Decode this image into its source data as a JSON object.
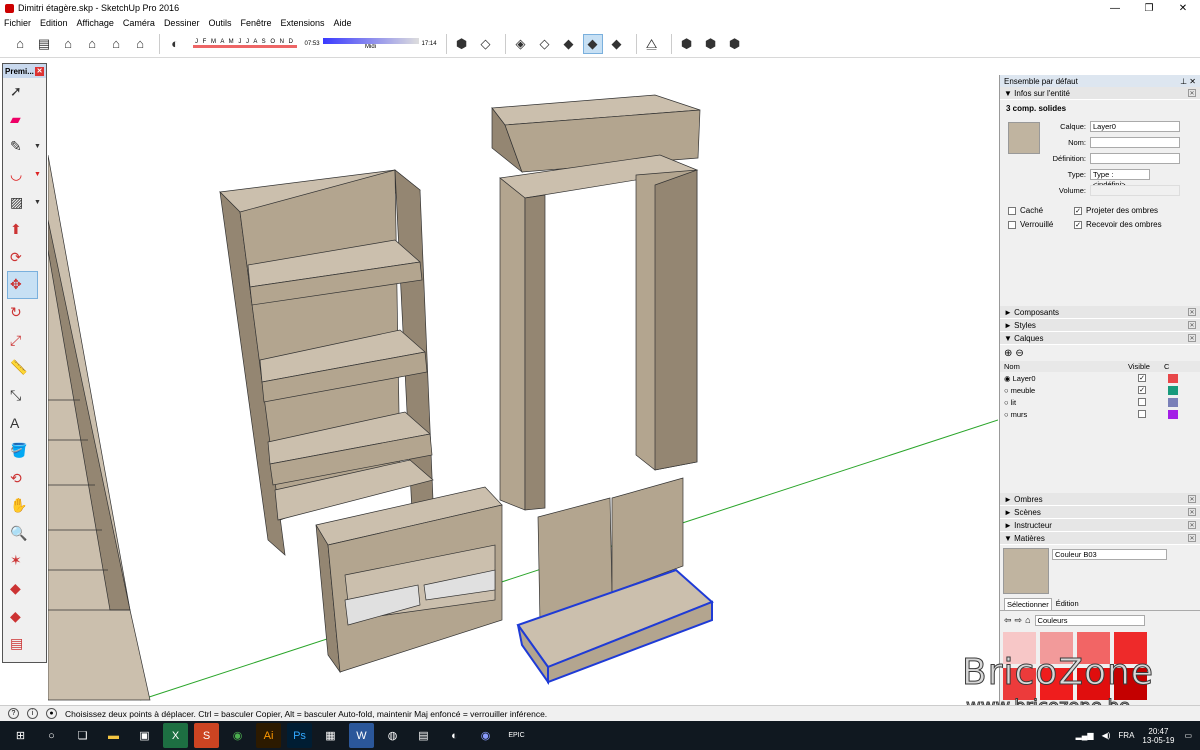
{
  "window": {
    "title": "Dimitri étagère.skp - SketchUp Pro 2016",
    "controls": [
      "—",
      "❐",
      "✕"
    ]
  },
  "menu": [
    "Fichier",
    "Edition",
    "Affichage",
    "Caméra",
    "Dessiner",
    "Outils",
    "Fenêtre",
    "Extensions",
    "Aide"
  ],
  "shadow": {
    "months": "J F M A M J J A S O N D",
    "time_start": "07:53",
    "time_mid": "Midi",
    "time_end": "17:14"
  },
  "palette": {
    "title": "Premi..."
  },
  "tray": {
    "title": "Ensemble par défaut",
    "entity_info": {
      "section": "Infos sur l'entité",
      "selection": "3 comp. solides",
      "layer_label": "Calque:",
      "layer_value": "Layer0",
      "name_label": "Nom:",
      "definition_label": "Définition:",
      "type_label": "Type:",
      "type_value": "Type : <indéfini>",
      "volume_label": "Volume:",
      "hidden": "Caché",
      "locked": "Verrouillé",
      "cast_shadows": "Projeter des ombres",
      "receive_shadows": "Recevoir des ombres"
    },
    "sections": {
      "components": "Composants",
      "styles": "Styles",
      "layers": "Calques",
      "shadows": "Ombres",
      "scenes": "Scènes",
      "instructor": "Instructeur",
      "materials": "Matières"
    },
    "layers": {
      "col_name": "Nom",
      "col_visible": "Visible",
      "col_color": "C",
      "rows": [
        {
          "name": "Layer0",
          "color": "#e8474a",
          "visible": true,
          "active": true
        },
        {
          "name": "meuble",
          "color": "#179a7c",
          "visible": true,
          "active": false
        },
        {
          "name": "lit",
          "color": "#7a80b8",
          "visible": false,
          "active": false
        },
        {
          "name": "murs",
          "color": "#a31fe6",
          "visible": false,
          "active": false
        }
      ]
    },
    "materials": {
      "current": "Couleur B03",
      "tab_select": "Sélectionner",
      "tab_edit": "Édition",
      "library": "Couleurs",
      "swatch_colors": [
        "#f7c7c7",
        "#f29a9a",
        "#f26565",
        "#ee2a2a",
        "#ec3b3b",
        "#ef1d1d",
        "#e00e0e",
        "#c40000"
      ]
    }
  },
  "statusbar": {
    "hint": "Choisissez deux points à déplacer.  Ctrl = basculer Copier, Alt = basculer Auto-fold, maintenir Maj enfoncé = verrouiller inférence."
  },
  "taskbar": {
    "lang": "FRA",
    "time": "20:47",
    "date": "13-05-19"
  },
  "watermark": {
    "brand": "BricoZone",
    "url": "www.bricozone.be"
  },
  "colors": {
    "wood_top": "#cbbfad",
    "wood_front": "#b3a58f",
    "wood_side": "#948672",
    "selection": "#1f3bd6",
    "axis_green": "#2aa52a"
  }
}
